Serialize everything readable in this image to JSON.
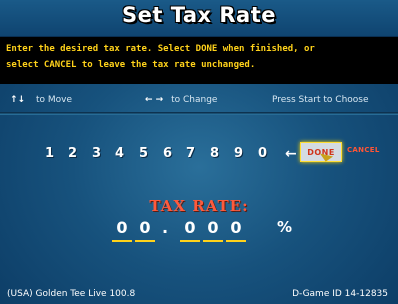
{
  "title": "Set Tax Rate",
  "instructions": {
    "line1": "Enter the desired tax rate.  Select DONE when finished, or",
    "line2": "select CANCEL to leave the tax rate unchanged."
  },
  "nav": {
    "move_arrows": "↑↓",
    "move_label": "to Move",
    "change_arrows": "← →",
    "change_label": "to Change",
    "start_label": "Press Start to Choose"
  },
  "keypad": {
    "keys": [
      "1",
      "2",
      "3",
      "4",
      "5",
      "6",
      "7",
      "8",
      "9",
      "0"
    ],
    "backspace_glyph": "←",
    "done_label": "DONE",
    "cancel_label": "CANCEL"
  },
  "tax": {
    "label": "TAX RATE:",
    "digits": [
      "0",
      "0",
      "0",
      "0",
      "0"
    ],
    "decimal": ".",
    "percent": "%"
  },
  "footer": {
    "left": "(USA) Golden Tee Live 100.8",
    "right": "D-Game ID 14-12835"
  },
  "colors": {
    "accent_yellow": "#ffd21a",
    "tax_label_red": "#ff5a3c",
    "background_blue": "#17527d"
  }
}
